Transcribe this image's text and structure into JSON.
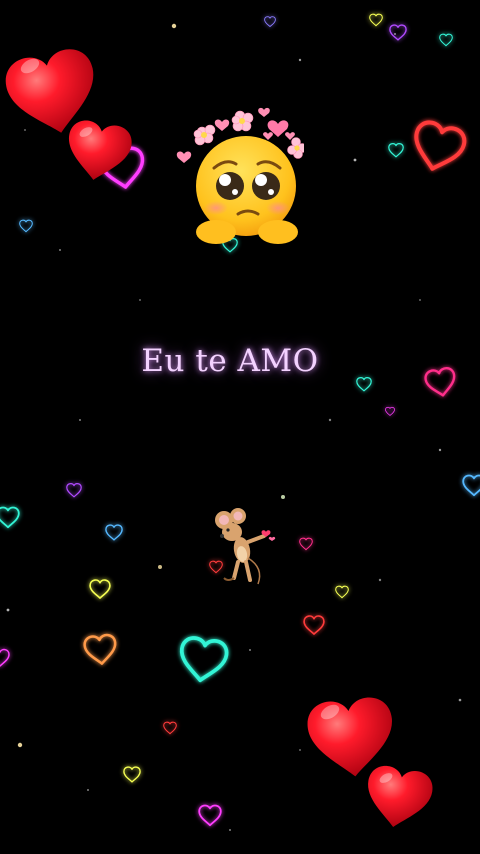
{
  "caption": {
    "text": "Eu te AMO",
    "color": "#f3d2ff",
    "glow": "#c86eff"
  },
  "scene": {
    "background": "#000000",
    "heart_colors": {
      "solid_red": "#e3001b",
      "neon_pink": "#ff2d8a",
      "neon_magenta": "#ff3dff",
      "neon_cyan": "#33f5d6",
      "neon_yellow": "#f6ff52",
      "neon_blue": "#55b8ff",
      "neon_orange": "#ff9a4a",
      "neon_red": "#ff3b3b"
    },
    "icons": [
      "pleading-face-flower-crown-icon",
      "mouse-with-hearts-icon",
      "heart-icon"
    ]
  }
}
